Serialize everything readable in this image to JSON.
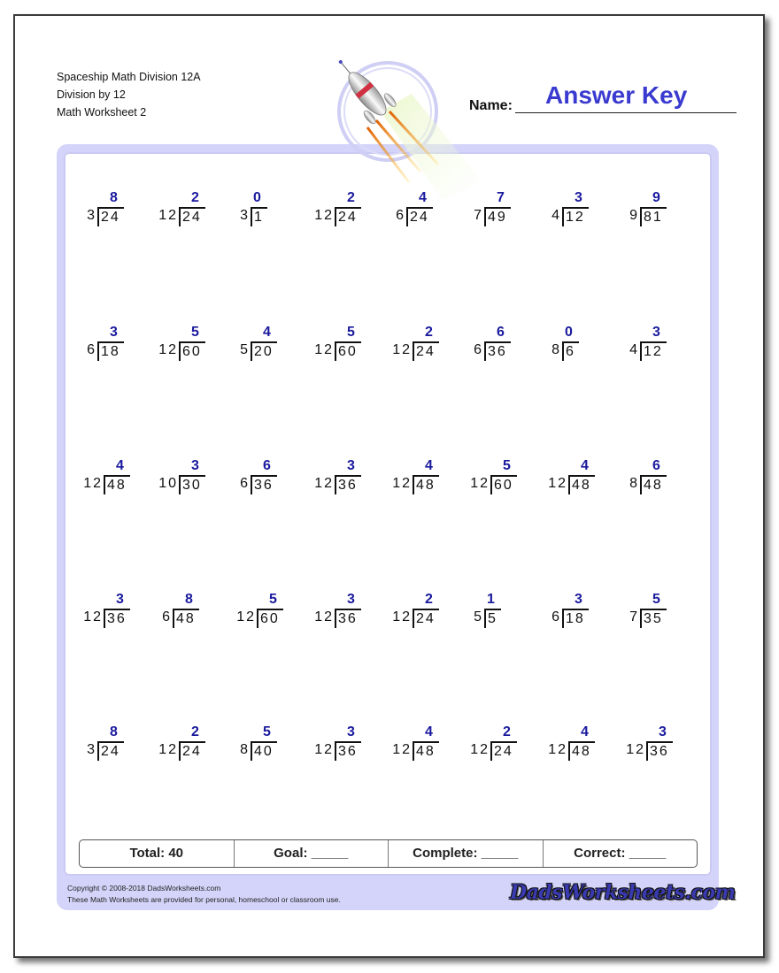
{
  "header": {
    "title": "Spaceship Math Division 12A",
    "subtitle": "Division by 12",
    "worksheet": "Math Worksheet 2",
    "name_label": "Name:",
    "name_value": "Answer Key"
  },
  "colors": {
    "answer": "#1a1a9e",
    "name_value": "#3a3ad0",
    "frame": "#d4d4fa"
  },
  "problems": [
    [
      {
        "answer": "8",
        "divisor": "3",
        "dividend": "24"
      },
      {
        "answer": "2",
        "divisor": "12",
        "dividend": "24"
      },
      {
        "answer": "0",
        "divisor": "3",
        "dividend": "1"
      },
      {
        "answer": "2",
        "divisor": "12",
        "dividend": "24"
      },
      {
        "answer": "4",
        "divisor": "6",
        "dividend": "24"
      },
      {
        "answer": "7",
        "divisor": "7",
        "dividend": "49"
      },
      {
        "answer": "3",
        "divisor": "4",
        "dividend": "12"
      },
      {
        "answer": "9",
        "divisor": "9",
        "dividend": "81"
      }
    ],
    [
      {
        "answer": "3",
        "divisor": "6",
        "dividend": "18"
      },
      {
        "answer": "5",
        "divisor": "12",
        "dividend": "60"
      },
      {
        "answer": "4",
        "divisor": "5",
        "dividend": "20"
      },
      {
        "answer": "5",
        "divisor": "12",
        "dividend": "60"
      },
      {
        "answer": "2",
        "divisor": "12",
        "dividend": "24"
      },
      {
        "answer": "6",
        "divisor": "6",
        "dividend": "36"
      },
      {
        "answer": "0",
        "divisor": "8",
        "dividend": "6"
      },
      {
        "answer": "3",
        "divisor": "4",
        "dividend": "12"
      }
    ],
    [
      {
        "answer": "4",
        "divisor": "12",
        "dividend": "48"
      },
      {
        "answer": "3",
        "divisor": "10",
        "dividend": "30"
      },
      {
        "answer": "6",
        "divisor": "6",
        "dividend": "36"
      },
      {
        "answer": "3",
        "divisor": "12",
        "dividend": "36"
      },
      {
        "answer": "4",
        "divisor": "12",
        "dividend": "48"
      },
      {
        "answer": "5",
        "divisor": "12",
        "dividend": "60"
      },
      {
        "answer": "4",
        "divisor": "12",
        "dividend": "48"
      },
      {
        "answer": "6",
        "divisor": "8",
        "dividend": "48"
      }
    ],
    [
      {
        "answer": "3",
        "divisor": "12",
        "dividend": "36"
      },
      {
        "answer": "8",
        "divisor": "6",
        "dividend": "48"
      },
      {
        "answer": "5",
        "divisor": "12",
        "dividend": "60"
      },
      {
        "answer": "3",
        "divisor": "12",
        "dividend": "36"
      },
      {
        "answer": "2",
        "divisor": "12",
        "dividend": "24"
      },
      {
        "answer": "1",
        "divisor": "5",
        "dividend": "5"
      },
      {
        "answer": "3",
        "divisor": "6",
        "dividend": "18"
      },
      {
        "answer": "5",
        "divisor": "7",
        "dividend": "35"
      }
    ],
    [
      {
        "answer": "8",
        "divisor": "3",
        "dividend": "24"
      },
      {
        "answer": "2",
        "divisor": "12",
        "dividend": "24"
      },
      {
        "answer": "5",
        "divisor": "8",
        "dividend": "40"
      },
      {
        "answer": "3",
        "divisor": "12",
        "dividend": "36"
      },
      {
        "answer": "4",
        "divisor": "12",
        "dividend": "48"
      },
      {
        "answer": "2",
        "divisor": "12",
        "dividend": "24"
      },
      {
        "answer": "4",
        "divisor": "12",
        "dividend": "48"
      },
      {
        "answer": "3",
        "divisor": "12",
        "dividend": "36"
      }
    ]
  ],
  "summary": {
    "total": "Total: 40",
    "goal": "Goal: _____",
    "complete": "Complete: _____",
    "correct": "Correct: _____"
  },
  "footer": {
    "copyright": "Copyright © 2008-2018 DadsWorksheets.com",
    "usage": "These Math Worksheets are provided for personal, homeschool or classroom use.",
    "logo": "DadsWorksheets.com"
  },
  "icons": {
    "rocket": "rocket-illustration"
  }
}
